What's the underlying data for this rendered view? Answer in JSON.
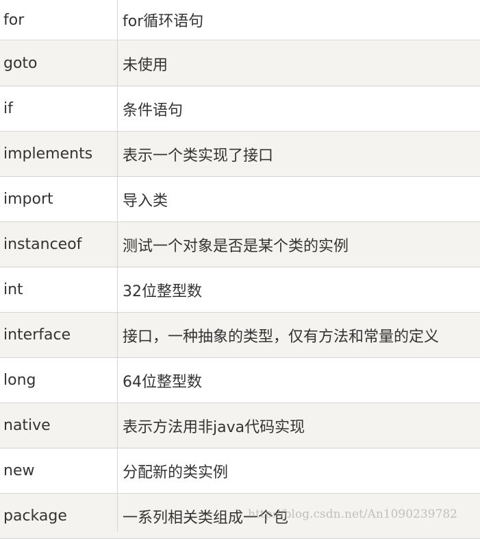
{
  "rows": [
    {
      "keyword": "for",
      "description": "for循环语句"
    },
    {
      "keyword": "goto",
      "description": "未使用"
    },
    {
      "keyword": "if",
      "description": "条件语句"
    },
    {
      "keyword": "implements",
      "description": "表示一个类实现了接口"
    },
    {
      "keyword": "import",
      "description": "导入类"
    },
    {
      "keyword": "instanceof",
      "description": "测试一个对象是否是某个类的实例"
    },
    {
      "keyword": "int",
      "description": "32位整型数"
    },
    {
      "keyword": "interface",
      "description": "接口，一种抽象的类型，仅有方法和常量的定义"
    },
    {
      "keyword": "long",
      "description": "64位整型数"
    },
    {
      "keyword": "native",
      "description": "表示方法用非java代码实现"
    },
    {
      "keyword": "new",
      "description": "分配新的类实例"
    },
    {
      "keyword": "package",
      "description": "一系列相关类组成一个包"
    }
  ],
  "watermark": "http://blog.csdn.net/An1090239782",
  "colors": {
    "row_alt": "#f4f3f0",
    "border": "#d4d4d4",
    "text": "#333333"
  }
}
